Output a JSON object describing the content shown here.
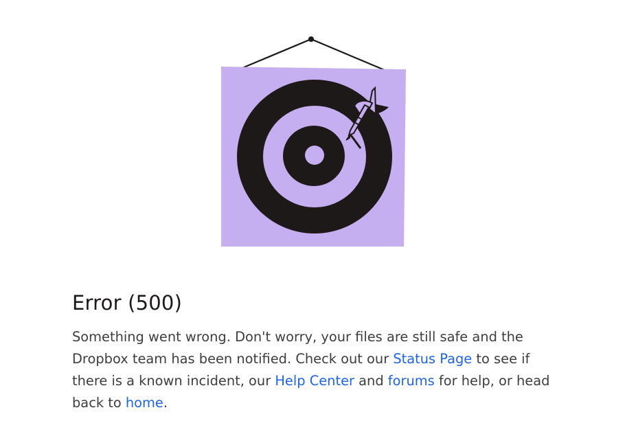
{
  "illustration": {
    "icon": "dartboard-target-icon",
    "colors": {
      "frame": "#c6aff0",
      "target": "#1e1919",
      "string": "#1e1919"
    }
  },
  "error": {
    "title": "Error (500)",
    "message_part1": "Something went wrong. Don't worry, your files are still safe and the Dropbox team has been notified. Check out our ",
    "status_link": "Status Page",
    "message_part2": " to see if there is a known incident, our ",
    "help_link": "Help Center",
    "message_part3": " and ",
    "forums_link": "forums",
    "message_part4": " for help, or head back to ",
    "home_link": "home",
    "message_part5": "."
  },
  "colors": {
    "link": "#1d63ed",
    "text": "#3d3d3d",
    "title": "#1e1919"
  }
}
